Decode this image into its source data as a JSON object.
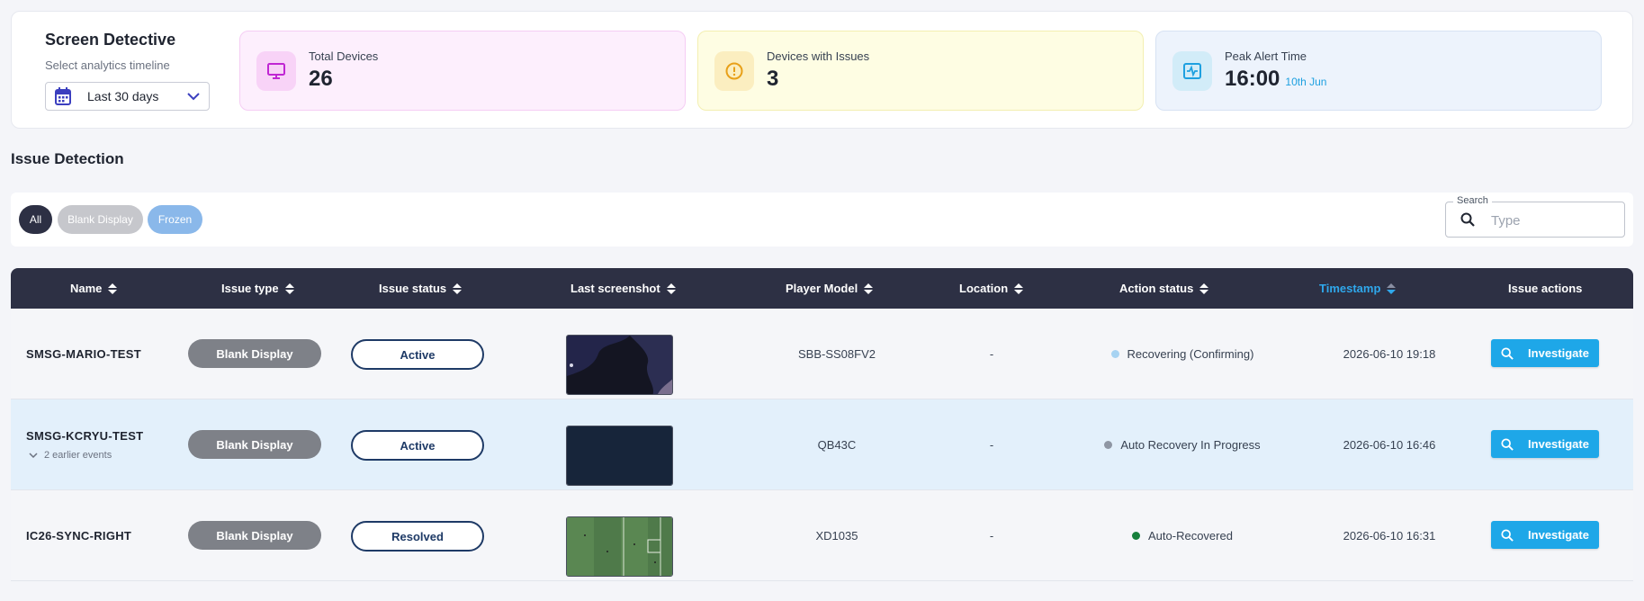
{
  "header": {
    "title": "Screen Detective",
    "subtitle": "Select analytics timeline",
    "timeline_value": "Last 30 days"
  },
  "stats": [
    {
      "label": "Total Devices",
      "value": "26",
      "icon": "monitor-icon",
      "color": "#c026d3"
    },
    {
      "label": "Devices with Issues",
      "value": "3",
      "icon": "alert-circle-icon",
      "color": "#e8a019"
    },
    {
      "label": "Peak Alert Time",
      "value": "16:00",
      "sub": "10th Jun",
      "icon": "pulse-icon",
      "color": "#1ea0e0"
    }
  ],
  "section_title": "Issue Detection",
  "filters": {
    "chips": [
      "All",
      "Blank Display",
      "Frozen"
    ],
    "search_label": "Search",
    "search_placeholder": "Type"
  },
  "table": {
    "columns": [
      "Name",
      "Issue type",
      "Issue status",
      "Last screenshot",
      "Player Model",
      "Location",
      "Action status",
      "Timestamp",
      "Issue actions"
    ],
    "rows": [
      {
        "name": "SMSG-MARIO-TEST",
        "issue_type": "Blank Display",
        "issue_status": "Active",
        "player_model": "SBB-SS08FV2",
        "location": "-",
        "action_status": "Recovering (Confirming)",
        "action_color": "#a7d3f2",
        "timestamp": "2026-06-10 19:18",
        "action_label": "Investigate"
      },
      {
        "name": "SMSG-KCRYU-TEST",
        "earlier_events": "2 earlier events",
        "issue_type": "Blank Display",
        "issue_status": "Active",
        "player_model": "QB43C",
        "location": "-",
        "action_status": "Auto Recovery In Progress",
        "action_color": "#8f96a3",
        "timestamp": "2026-06-10 16:46",
        "action_label": "Investigate"
      },
      {
        "name": "IC26-SYNC-RIGHT",
        "issue_type": "Blank Display",
        "issue_status": "Resolved",
        "player_model": "XD1035",
        "location": "-",
        "action_status": "Auto-Recovered",
        "action_color": "#16803c",
        "timestamp": "2026-06-10 16:31",
        "action_label": "Investigate"
      }
    ]
  }
}
